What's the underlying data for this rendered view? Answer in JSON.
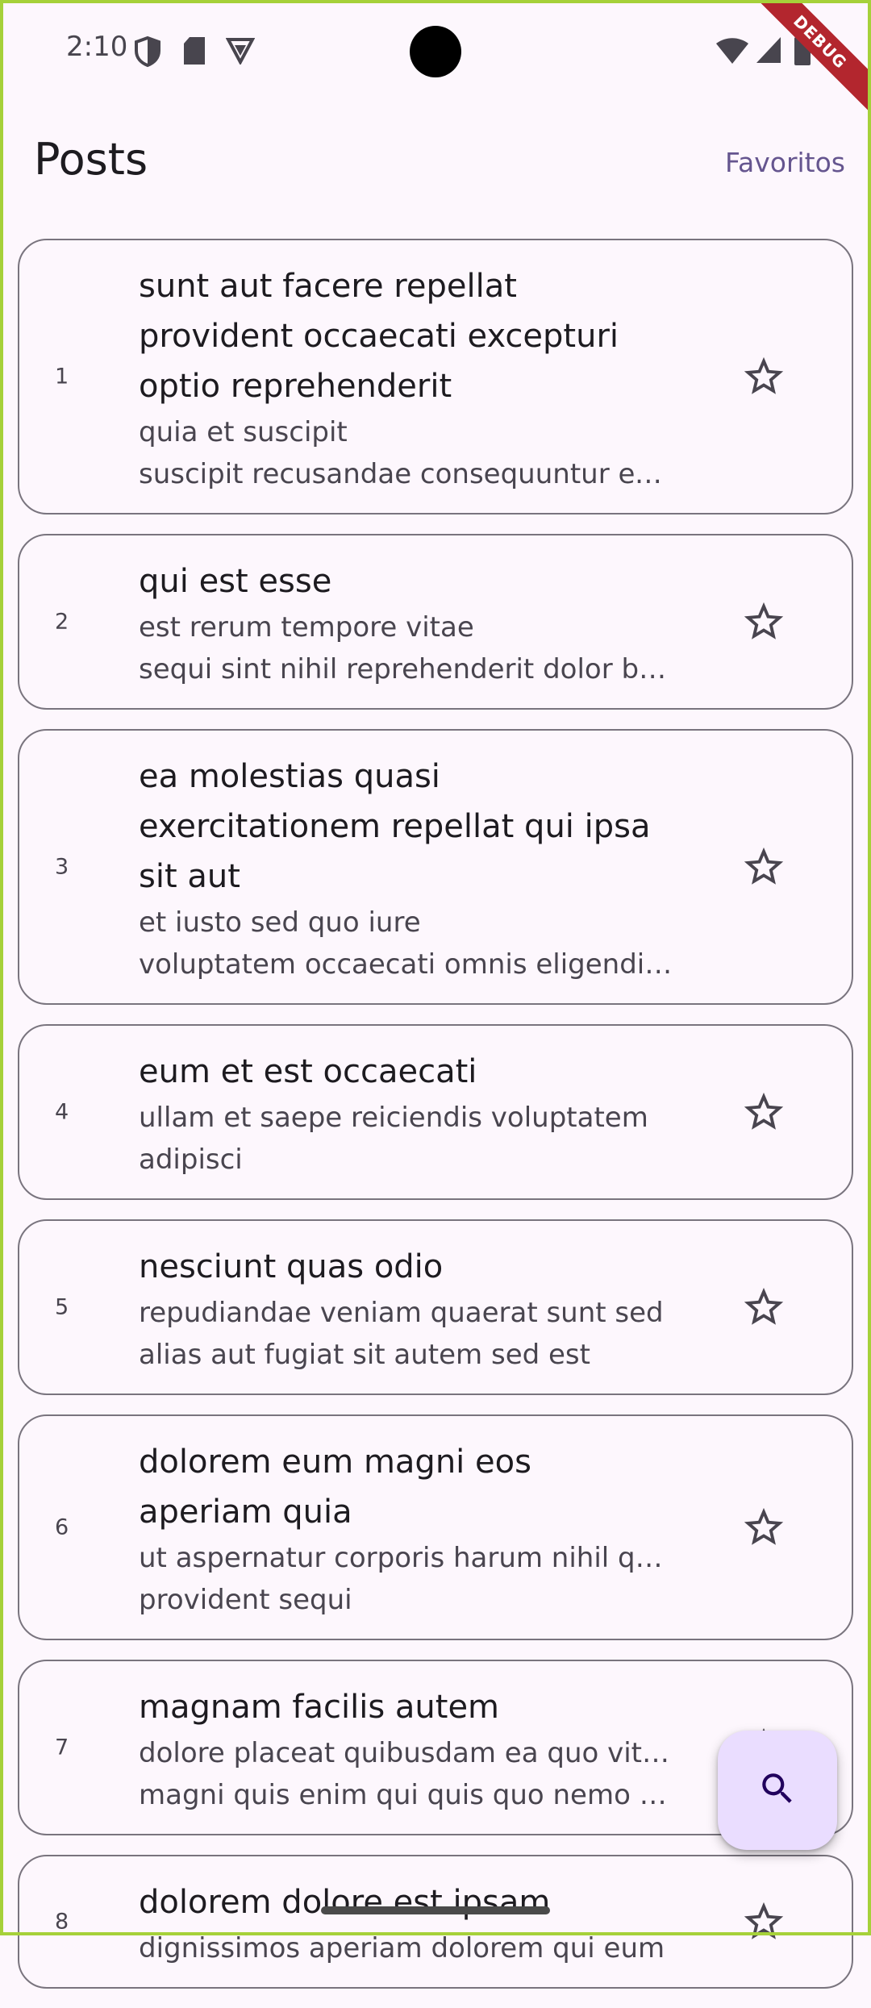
{
  "status_bar": {
    "time": "2:10",
    "icons": [
      "shield-icon",
      "sd-card-icon",
      "vpn-icon",
      "wifi-icon",
      "signal-icon",
      "battery-icon"
    ]
  },
  "debug_banner": "DEBUG",
  "app_bar": {
    "title": "Posts",
    "favorites_label": "Favoritos"
  },
  "posts": [
    {
      "id": "1",
      "title": "sunt aut facere repellat provident occaecati excepturi optio reprehenderit",
      "body_lines": [
        "quia et suscipit",
        "suscipit recusandae consequuntur ex..."
      ]
    },
    {
      "id": "2",
      "title": "qui est esse",
      "body_lines": [
        "est rerum tempore vitae",
        "sequi sint nihil reprehenderit dolor be..."
      ]
    },
    {
      "id": "3",
      "title": "ea molestias quasi exercitationem repellat qui ipsa sit aut",
      "body_lines": [
        "et iusto sed quo iure",
        "voluptatem occaecati omnis eligendi ..."
      ]
    },
    {
      "id": "4",
      "title": "eum et est occaecati",
      "body_lines": [
        "ullam et saepe reiciendis voluptatem",
        "adipisci"
      ]
    },
    {
      "id": "5",
      "title": "nesciunt quas odio",
      "body_lines": [
        "repudiandae veniam quaerat sunt sed",
        "alias aut fugiat sit autem sed est"
      ]
    },
    {
      "id": "6",
      "title": "dolorem eum magni eos aperiam quia",
      "body_lines": [
        "ut aspernatur corporis harum nihil quis",
        "provident sequi"
      ]
    },
    {
      "id": "7",
      "title": "magnam facilis autem",
      "body_lines": [
        "dolore placeat quibusdam ea quo vitae",
        "magni quis enim qui quis quo nemo au..."
      ]
    },
    {
      "id": "8",
      "title": "dolorem dolore est ipsam",
      "body_lines": [
        "dignissimos aperiam dolorem qui eum",
        ""
      ]
    }
  ],
  "fab": {
    "icon": "search-icon"
  },
  "colors": {
    "background": "#fdf7fd",
    "accent": "#65558f",
    "fab": "#eaddff",
    "outline": "#79747e",
    "frame": "#a6d13a"
  }
}
